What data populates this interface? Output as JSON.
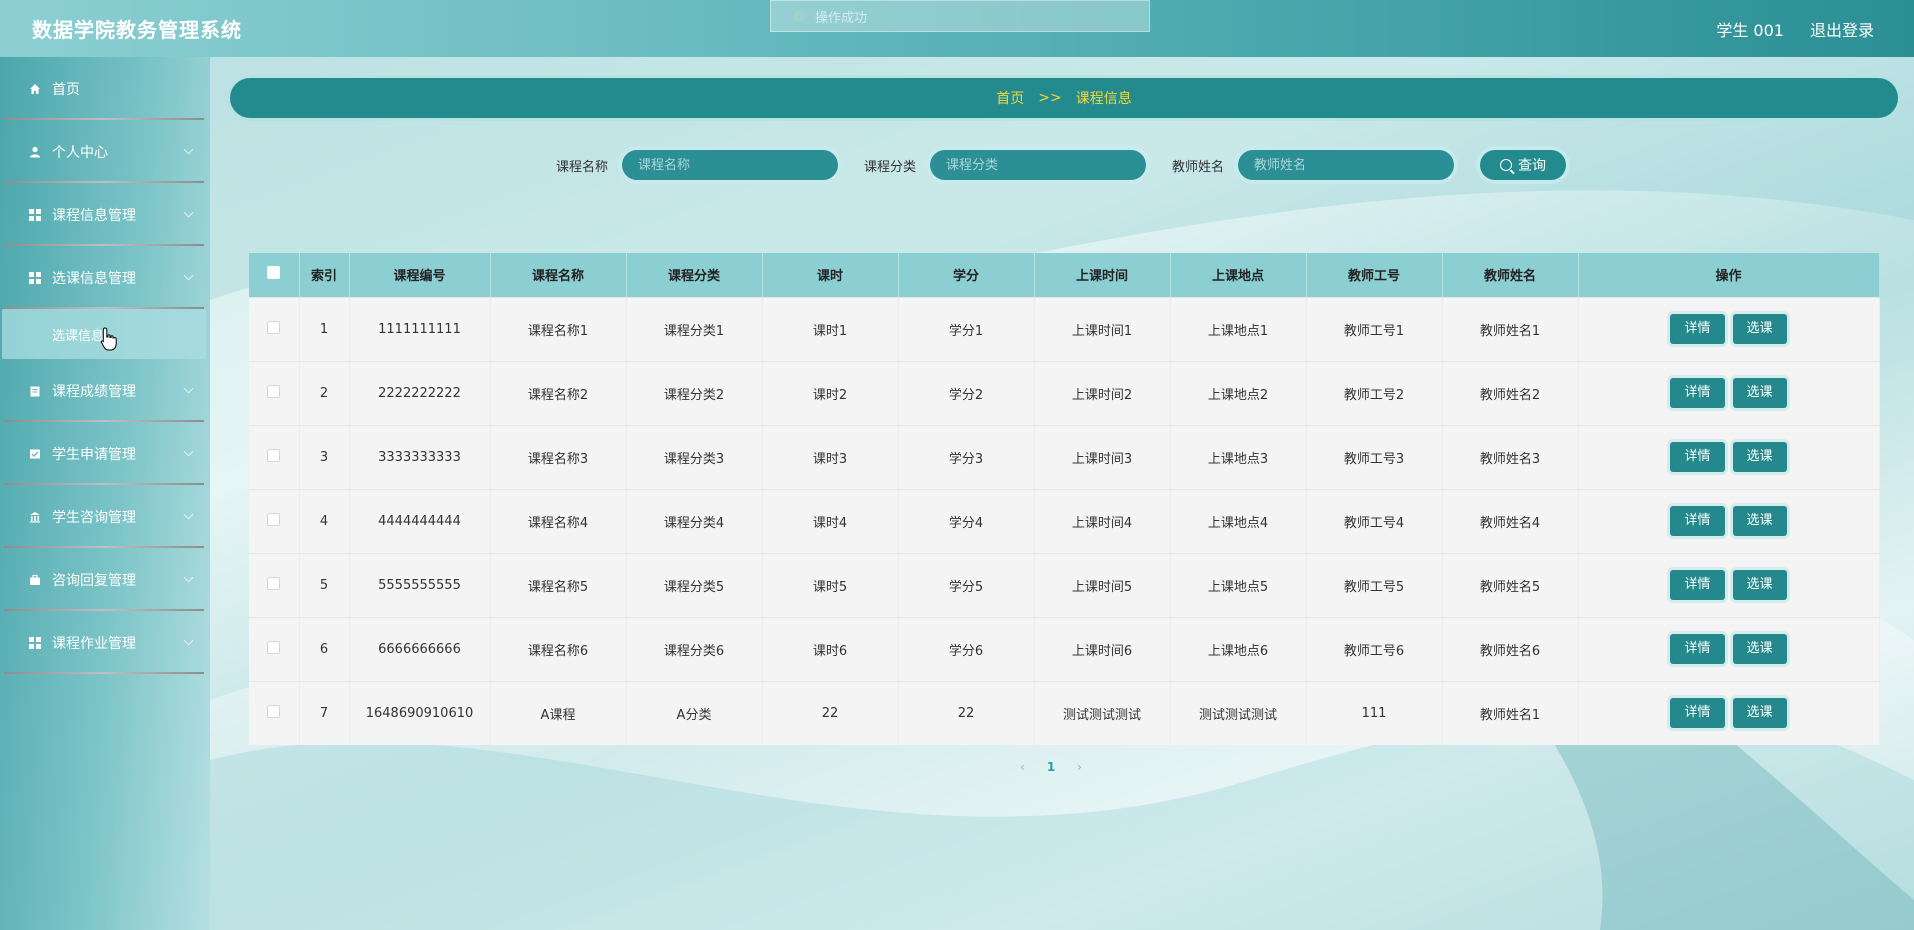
{
  "header": {
    "app_title": "数据学院教务管理系统",
    "user_label": "学生 001",
    "logout_label": "退出登录"
  },
  "toast": {
    "text": "操作成功"
  },
  "sidebar": {
    "items": [
      {
        "label": "首页",
        "icon": "home-icon"
      },
      {
        "label": "个人中心",
        "icon": "user-icon"
      },
      {
        "label": "课程信息管理",
        "icon": "grid-icon"
      },
      {
        "label": "选课信息管理",
        "icon": "grid-icon"
      },
      {
        "label": "课程成绩管理",
        "icon": "clipboard-icon"
      },
      {
        "label": "学生申请管理",
        "icon": "checklist-icon"
      },
      {
        "label": "学生咨询管理",
        "icon": "bank-icon"
      },
      {
        "label": "咨询回复管理",
        "icon": "briefcase-icon"
      },
      {
        "label": "课程作业管理",
        "icon": "grid-icon"
      }
    ],
    "submenu_active": "选课信息"
  },
  "breadcrumb": {
    "home": "首页",
    "separator": ">>",
    "current": "课程信息"
  },
  "search": {
    "course_name_label": "课程名称",
    "course_name_placeholder": "课程名称",
    "course_category_label": "课程分类",
    "course_category_placeholder": "课程分类",
    "teacher_name_label": "教师姓名",
    "teacher_name_placeholder": "教师姓名",
    "query_button": "查询"
  },
  "table": {
    "columns": [
      "索引",
      "课程编号",
      "课程名称",
      "课程分类",
      "课时",
      "学分",
      "上课时间",
      "上课地点",
      "教师工号",
      "教师姓名",
      "操作"
    ],
    "detail_button": "详情",
    "select_button": "选课",
    "rows": [
      [
        "1",
        "1111111111",
        "课程名称1",
        "课程分类1",
        "课时1",
        "学分1",
        "上课时间1",
        "上课地点1",
        "教师工号1",
        "教师姓名1"
      ],
      [
        "2",
        "2222222222",
        "课程名称2",
        "课程分类2",
        "课时2",
        "学分2",
        "上课时间2",
        "上课地点2",
        "教师工号2",
        "教师姓名2"
      ],
      [
        "3",
        "3333333333",
        "课程名称3",
        "课程分类3",
        "课时3",
        "学分3",
        "上课时间3",
        "上课地点3",
        "教师工号3",
        "教师姓名3"
      ],
      [
        "4",
        "4444444444",
        "课程名称4",
        "课程分类4",
        "课时4",
        "学分4",
        "上课时间4",
        "上课地点4",
        "教师工号4",
        "教师姓名4"
      ],
      [
        "5",
        "5555555555",
        "课程名称5",
        "课程分类5",
        "课时5",
        "学分5",
        "上课时间5",
        "上课地点5",
        "教师工号5",
        "教师姓名5"
      ],
      [
        "6",
        "6666666666",
        "课程名称6",
        "课程分类6",
        "课时6",
        "学分6",
        "上课时间6",
        "上课地点6",
        "教师工号6",
        "教师姓名6"
      ],
      [
        "7",
        "1648690910610",
        "A课程",
        "A分类",
        "22",
        "22",
        "测试测试测试",
        "测试测试测试",
        "111",
        "教师姓名1"
      ]
    ]
  },
  "pagination": {
    "prev": "‹",
    "current": "1",
    "next": "›"
  }
}
